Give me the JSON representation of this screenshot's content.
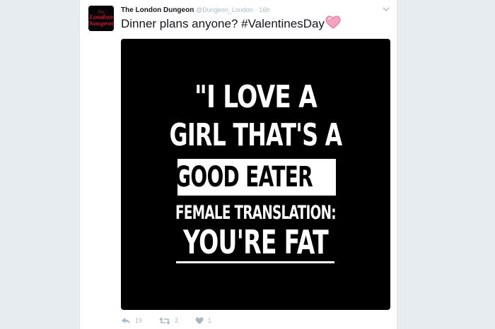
{
  "tweet": {
    "display_name": "The London Dungeon",
    "handle": "@Dungeon_London",
    "separator": "·",
    "time": "16h",
    "text": "Dinner plans anyone? #ValentinesDay",
    "emoji": "heart-emoji"
  },
  "avatar": {
    "lines": [
      "the",
      "London",
      "Dungeon"
    ],
    "color": "#c8102e"
  },
  "media": {
    "lines": [
      "\"I LOVE A",
      "GIRL THAT'S A",
      "GOOD EATER",
      "FEMALE TRANSLATION:",
      "YOU'RE FAT"
    ],
    "closing_quote": "\"",
    "background": "#000000",
    "text_color": "#ffffff"
  },
  "actions": {
    "reply_icon": "reply-icon",
    "reply_count": "19",
    "retweet_icon": "retweet-icon",
    "retweet_count": "2",
    "like_icon": "heart-icon",
    "like_count": "1"
  },
  "colors": {
    "page_background": "#e6ecf0",
    "card_background": "#ffffff",
    "muted_text": "#aab8c2",
    "primary_text": "#14171a"
  }
}
